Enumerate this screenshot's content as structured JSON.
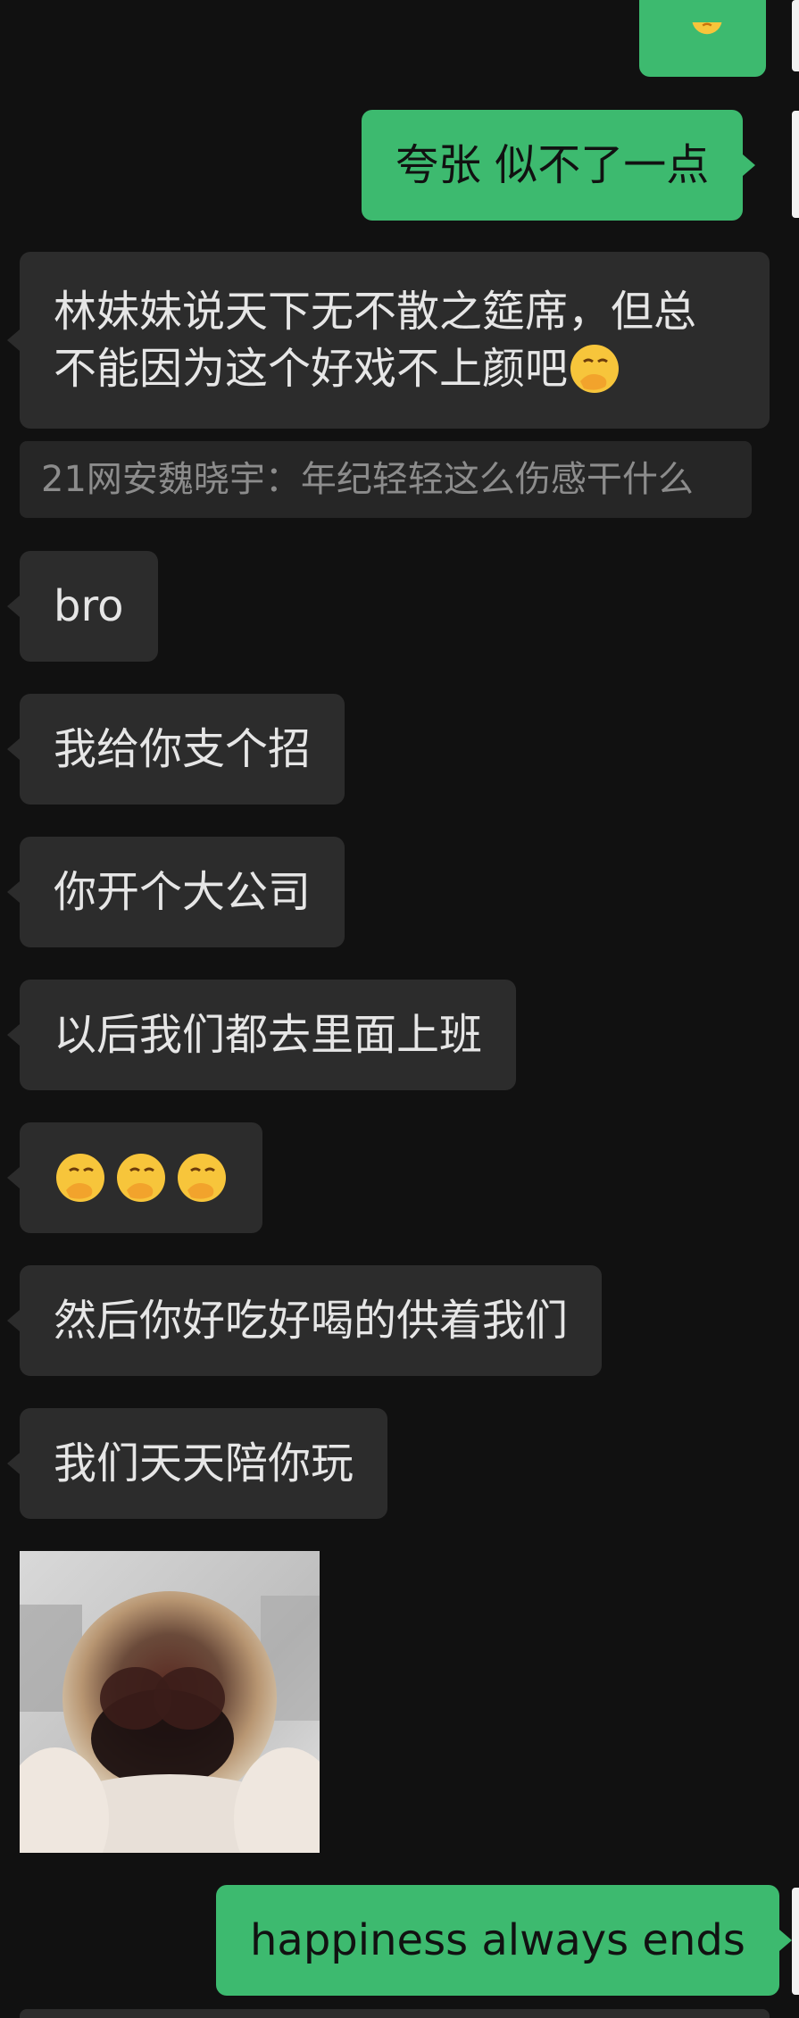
{
  "messages": [
    {
      "side": "right",
      "text": "夸张 似不了一点"
    },
    {
      "side": "left",
      "line1": "林妹妹说天下无不散之筵席，但总",
      "line2": "不能因为这个好戏不上颜吧"
    },
    {
      "quote": "21网安魏晓宇：年纪轻轻这么伤感干什么"
    },
    {
      "side": "left",
      "text": "bro"
    },
    {
      "side": "left",
      "text": "我给你支个招"
    },
    {
      "side": "left",
      "text": "你开个大公司"
    },
    {
      "side": "left",
      "text": "以后我们都去里面上班"
    },
    {
      "side": "left",
      "emoji": "face-with-hand-over-mouth x3"
    },
    {
      "side": "left",
      "text": "然后你好吃好喝的供着我们"
    },
    {
      "side": "left",
      "text": "我们天天陪你玩"
    },
    {
      "side": "left",
      "image": "monkey-sticker"
    },
    {
      "side": "right",
      "text": "happiness always ends"
    }
  ],
  "colors": {
    "background": "#111111",
    "incoming_bubble": "#2c2c2c",
    "outgoing_bubble": "#3dba6f",
    "quote_bg": "#262626"
  },
  "icons": {
    "emoji": "face-with-hand-over-mouth-emoji"
  }
}
